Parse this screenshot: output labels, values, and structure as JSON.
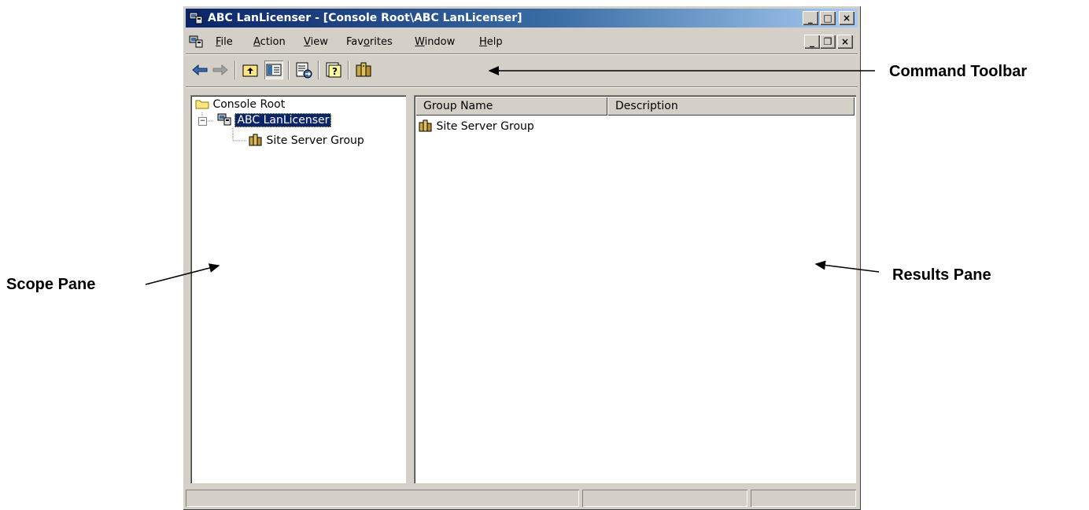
{
  "window": {
    "title": "ABC LanLicenser - [Console Root\\ABC LanLicenser]",
    "caption_buttons": [
      "_",
      "□",
      "×"
    ]
  },
  "menu": {
    "items": [
      {
        "pre": "",
        "key": "F",
        "post": "ile"
      },
      {
        "pre": "",
        "key": "A",
        "post": "ction"
      },
      {
        "pre": "",
        "key": "V",
        "post": "iew"
      },
      {
        "pre": "Fav",
        "key": "o",
        "post": "rites"
      },
      {
        "pre": "",
        "key": "W",
        "post": "indow"
      },
      {
        "pre": "",
        "key": "H",
        "post": "elp"
      }
    ],
    "mdi_buttons": [
      "_",
      "❐",
      "×"
    ]
  },
  "toolbar": {
    "buttons": [
      "back-arrow-icon",
      "forward-arrow-icon",
      "up-one-level-icon",
      "show-hide-tree-icon",
      "export-list-icon",
      "help-icon",
      "site-server-group-icon"
    ]
  },
  "scope": {
    "tree": {
      "root": "Console Root",
      "node": "ABC LanLicenser",
      "child": "Site Server Group",
      "node_expander": "−"
    }
  },
  "results": {
    "columns": [
      "Group Name",
      "Description"
    ],
    "rows": [
      {
        "name": "Site Server Group",
        "description": ""
      }
    ]
  },
  "callouts": {
    "command_toolbar": "Command Toolbar",
    "scope_pane": "Scope Pane",
    "results_pane": "Results Pane"
  },
  "colors": {
    "title_active": "#0a246a",
    "face": "#d4d0c8",
    "selection": "#0a246a"
  }
}
